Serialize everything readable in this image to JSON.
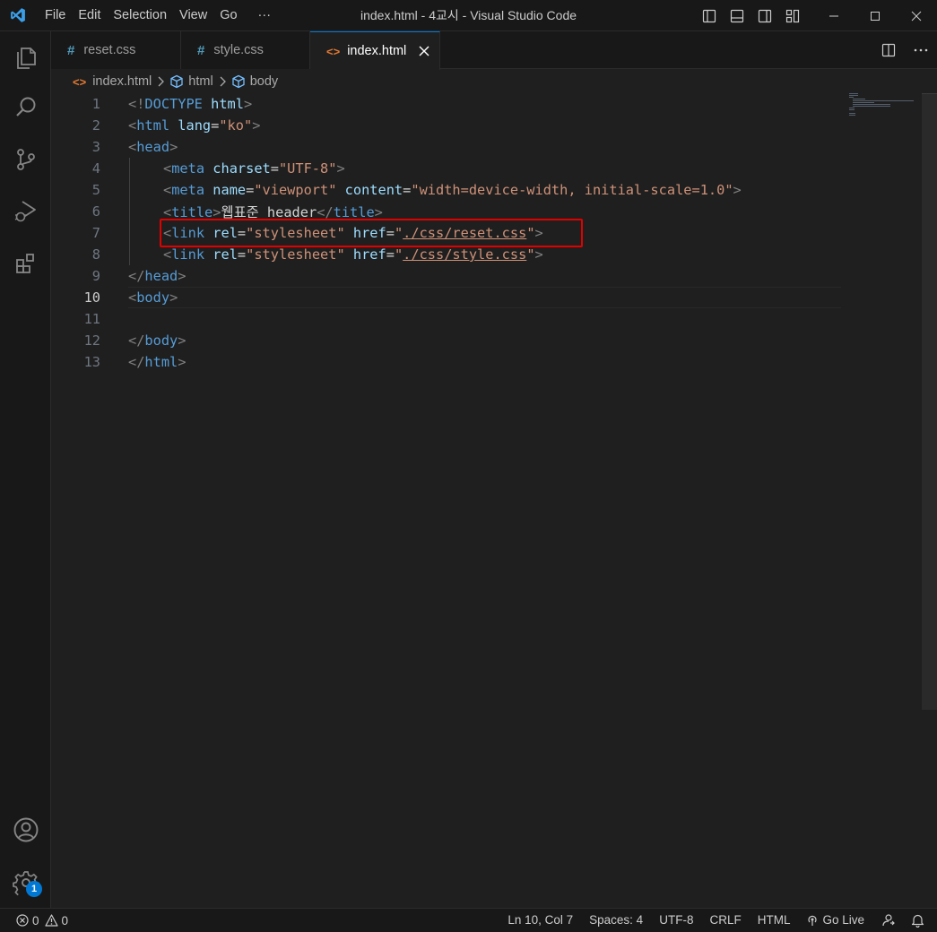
{
  "titlebar": {
    "menu": [
      "File",
      "Edit",
      "Selection",
      "View",
      "Go",
      "···"
    ],
    "title": "index.html - 4교시 - Visual Studio Code"
  },
  "tabs": [
    {
      "label": "reset.css",
      "type": "css",
      "active": false
    },
    {
      "label": "style.css",
      "type": "css",
      "active": false
    },
    {
      "label": "index.html",
      "type": "html",
      "active": true
    }
  ],
  "breadcrumb": [
    "index.html",
    "html",
    "body"
  ],
  "editor": {
    "current_line": 10,
    "line_numbers": [
      "1",
      "2",
      "3",
      "4",
      "5",
      "6",
      "7",
      "8",
      "9",
      "10",
      "11",
      "12",
      "13"
    ],
    "lines": {
      "l1": {
        "open": "<!",
        "doctype": "DOCTYPE",
        "html": "html",
        "close": ">"
      },
      "l2": {
        "open": "<",
        "tag": "html",
        "attr": "lang",
        "eq": "=",
        "val": "\"ko\"",
        "close": ">"
      },
      "l3": {
        "open": "<",
        "tag": "head",
        "close": ">"
      },
      "l4": {
        "open": "<",
        "tag": "meta",
        "attr": "charset",
        "eq": "=",
        "val": "\"UTF-8\"",
        "close": ">"
      },
      "l5": {
        "open": "<",
        "tag": "meta",
        "attr1": "name",
        "eq1": "=",
        "val1": "\"viewport\"",
        "attr2": "content",
        "eq2": "=",
        "val2": "\"width=device-width, initial-scale=1.0\"",
        "close": ">"
      },
      "l6": {
        "open": "<",
        "tag": "title",
        "close": ">",
        "text": "웹표준_header",
        "open2": "</",
        "tag2": "title",
        "close2": ">"
      },
      "l7": {
        "open": "<",
        "tag": "link",
        "attr1": "rel",
        "eq1": "=",
        "val1": "\"stylesheet\"",
        "attr2": "href",
        "eq2": "=",
        "q1": "\"",
        "href": "./css/reset.css",
        "q2": "\"",
        "close": ">"
      },
      "l8": {
        "open": "<",
        "tag": "link",
        "attr1": "rel",
        "eq1": "=",
        "val1": "\"stylesheet\"",
        "attr2": "href",
        "eq2": "=",
        "q1": "\"",
        "href": "./css/style.css",
        "q2": "\"",
        "close": ">"
      },
      "l9": {
        "open": "</",
        "tag": "head",
        "close": ">"
      },
      "l10": {
        "open": "<",
        "tag": "body",
        "close": ">"
      },
      "l12": {
        "open": "</",
        "tag": "body",
        "close": ">"
      },
      "l13": {
        "open": "</",
        "tag": "html",
        "close": ">"
      }
    }
  },
  "activitybar": {
    "icons": [
      "explorer-icon",
      "search-icon",
      "source-control-icon",
      "run-debug-icon",
      "extensions-icon",
      "account-icon",
      "settings-gear-icon"
    ],
    "settings_badge": "1"
  },
  "statusbar": {
    "errors": "0",
    "warnings": "0",
    "position": "Ln 10, Col 7",
    "spaces": "Spaces: 4",
    "encoding": "UTF-8",
    "eol": "CRLF",
    "language": "HTML",
    "golive": "Go Live"
  },
  "colors": {
    "accent": "#0078d4",
    "highlight_box": "#e00000",
    "tag": "#569cd6",
    "attr": "#9cdcfe",
    "string": "#ce9178"
  }
}
